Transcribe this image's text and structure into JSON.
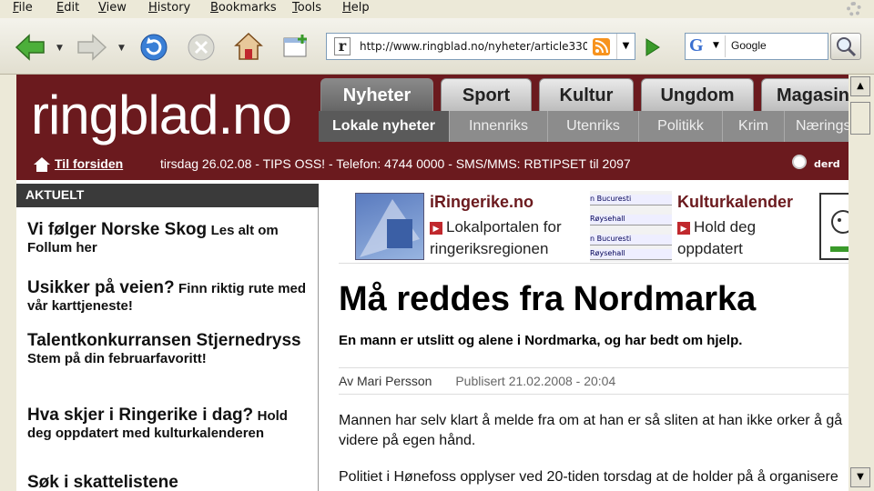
{
  "browser": {
    "menu": [
      "File",
      "Edit",
      "View",
      "History",
      "Bookmarks",
      "Tools",
      "Help"
    ],
    "url": "http://www.ringblad.no/nyheter/article330",
    "search_engine": "G",
    "search_placeholder": "Google"
  },
  "site": {
    "logo": "ringblad.no",
    "home_link": "Til forsiden",
    "date_info": "tirsdag 26.02.08 - TIPS OSS! - Telefon: 4744 0000 - SMS/MMS: RBTIPSET til 2097",
    "radio_label": "derd",
    "main_tabs": [
      "Nyheter",
      "Sport",
      "Kultur",
      "Ungdom",
      "Magasin"
    ],
    "sub_tabs": [
      "Lokale nyheter",
      "Innenriks",
      "Utenriks",
      "Politikk",
      "Krim",
      "Nærings"
    ]
  },
  "sidebar": {
    "title": "AKTUELT",
    "items": [
      {
        "headline": "Vi følger Norske Skog",
        "sub": "Les alt om Follum her"
      },
      {
        "headline": "Usikker på veien?",
        "sub": "Finn riktig rute med vår karttjeneste!"
      },
      {
        "headline": "Talentkonkurransen Stjernedryss",
        "sub": "Stem på din februarfavoritt!"
      },
      {
        "headline": "Hva skjer i Ringerike i dag?",
        "sub": "Hold deg oppdatert med kulturkalenderen"
      },
      {
        "headline": "Søk i skattelistene",
        "sub": ""
      }
    ]
  },
  "promo": {
    "iringerike_title": "iRingerike.no",
    "iringerike_text": "Lokalportalen for ringeriksregionen",
    "mini_rows": [
      "n Bucuresti",
      "Røysehall",
      "n Bucuresti",
      "Røysehall",
      "n Bucuresti",
      "Røysehall"
    ],
    "kultur_title": "Kulturkalender",
    "kultur_text": "Hold deg oppdatert"
  },
  "article": {
    "headline": "Må reddes fra Nordmarka",
    "subhead": "En mann er utslitt og alene i Nordmarka, og har bedt om hjelp.",
    "author": "Av Mari Persson",
    "published": "Publisert 21.02.2008 - 20:04",
    "para1": "Mannen har selv klart å melde fra om at han er så sliten at han ikke orker å gå videre på egen hånd.",
    "para2": "Politiet i Hønefoss opplyser ved 20-tiden torsdag at de holder på å organisere"
  },
  "colors": {
    "brand": "#6b1a1e",
    "accent": "#c0282d"
  }
}
